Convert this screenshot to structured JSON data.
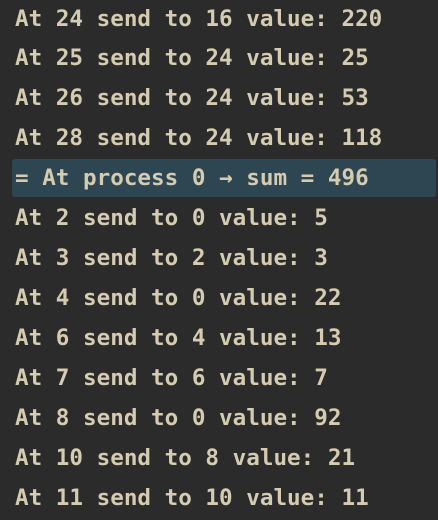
{
  "console": {
    "lines": [
      {
        "text": "At 24 send to 16 value: 220",
        "highlighted": false
      },
      {
        "text": "At 25 send to 24 value: 25",
        "highlighted": false
      },
      {
        "text": "At 26 send to 24 value: 53",
        "highlighted": false
      },
      {
        "text": "At 28 send to 24 value: 118",
        "highlighted": false
      },
      {
        "text": "= At process 0 → sum = 496",
        "highlighted": true
      },
      {
        "text": "At 2 send to 0 value: 5",
        "highlighted": false
      },
      {
        "text": "At 3 send to 2 value: 3",
        "highlighted": false
      },
      {
        "text": "At 4 send to 0 value: 22",
        "highlighted": false
      },
      {
        "text": "At 6 send to 4 value: 13",
        "highlighted": false
      },
      {
        "text": "At 7 send to 6 value: 7",
        "highlighted": false
      },
      {
        "text": "At 8 send to 0 value: 92",
        "highlighted": false
      },
      {
        "text": "At 10 send to 8 value: 21",
        "highlighted": false
      },
      {
        "text": "At 11 send to 10 value: 11",
        "highlighted": false
      }
    ]
  }
}
